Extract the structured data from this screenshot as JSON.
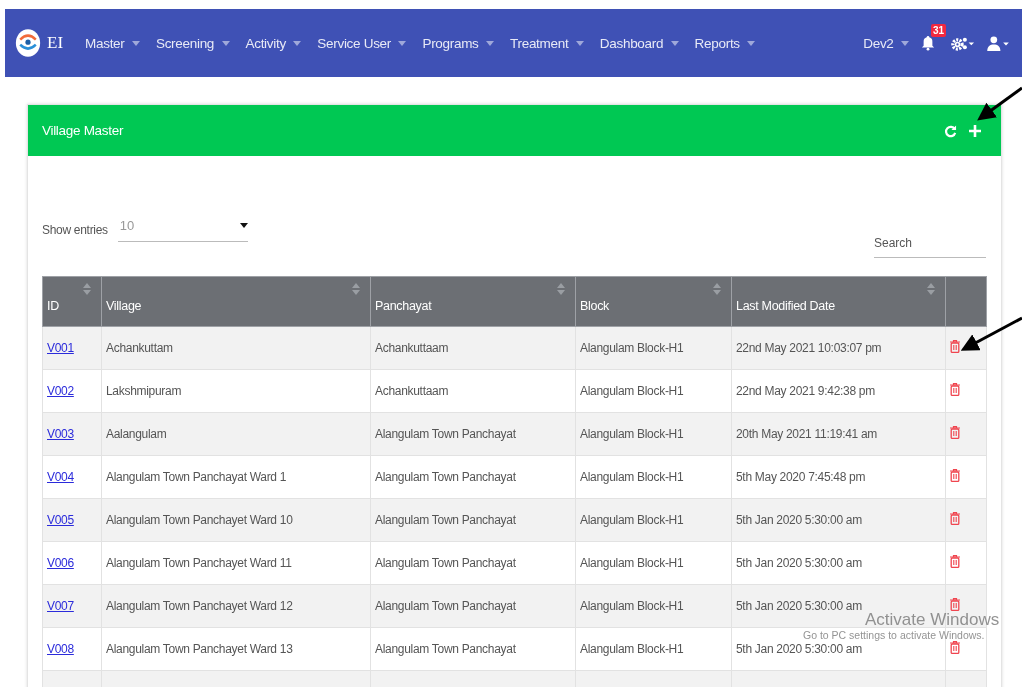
{
  "navbar": {
    "brand": "EI",
    "menus": [
      "Master",
      "Screening",
      "Activity",
      "Service User",
      "Programs",
      "Treatment",
      "Dashboard",
      "Reports"
    ],
    "user": "Dev2",
    "notifications": "31"
  },
  "panel": {
    "title": "Village Master"
  },
  "length": {
    "label": "Show entries",
    "value": "10"
  },
  "search": {
    "placeholder": "Search"
  },
  "table": {
    "columns": [
      {
        "label": "ID",
        "sortable": true
      },
      {
        "label": "Village",
        "sortable": true
      },
      {
        "label": "Panchayat",
        "sortable": true
      },
      {
        "label": "Block",
        "sortable": true
      },
      {
        "label": "Last Modified Date",
        "sortable": true
      },
      {
        "sortable": false
      }
    ],
    "rows": [
      {
        "id": "V001",
        "village": "Achankuttam",
        "panchayat": "Achankuttaam",
        "block": "Alangulam Block-H1",
        "modified": "22nd May 2021 10:03:07 pm"
      },
      {
        "id": "V002",
        "village": "Lakshmipuram",
        "panchayat": "Achankuttaam",
        "block": "Alangulam Block-H1",
        "modified": "22nd May 2021 9:42:38 pm"
      },
      {
        "id": "V003",
        "village": "Aalangulam",
        "panchayat": "Alangulam Town Panchayat",
        "block": "Alangulam Block-H1",
        "modified": "20th May 2021 11:19:41 am"
      },
      {
        "id": "V004",
        "village": "Alangulam Town Panchayat Ward 1",
        "panchayat": "Alangulam Town Panchayat",
        "block": "Alangulam Block-H1",
        "modified": "5th May 2020 7:45:48 pm"
      },
      {
        "id": "V005",
        "village": "Alangulam Town Panchayet Ward 10",
        "panchayat": "Alangulam Town Panchayat",
        "block": "Alangulam Block-H1",
        "modified": "5th Jan 2020 5:30:00 am"
      },
      {
        "id": "V006",
        "village": "Alangulam Town Panchayet Ward 11",
        "panchayat": "Alangulam Town Panchayat",
        "block": "Alangulam Block-H1",
        "modified": "5th Jan 2020 5:30:00 am"
      },
      {
        "id": "V007",
        "village": "Alangulam Town Panchayet Ward 12",
        "panchayat": "Alangulam Town Panchayat",
        "block": "Alangulam Block-H1",
        "modified": "5th Jan 2020 5:30:00 am"
      },
      {
        "id": "V008",
        "village": "Alangulam Town Panchayet Ward 13",
        "panchayat": "Alangulam Town Panchayat",
        "block": "Alangulam Block-H1",
        "modified": "5th Jan 2020 5:30:00 am"
      }
    ]
  },
  "os_notice": {
    "title": "Activate Windows",
    "message": "Go to PC settings to activate Windows."
  }
}
